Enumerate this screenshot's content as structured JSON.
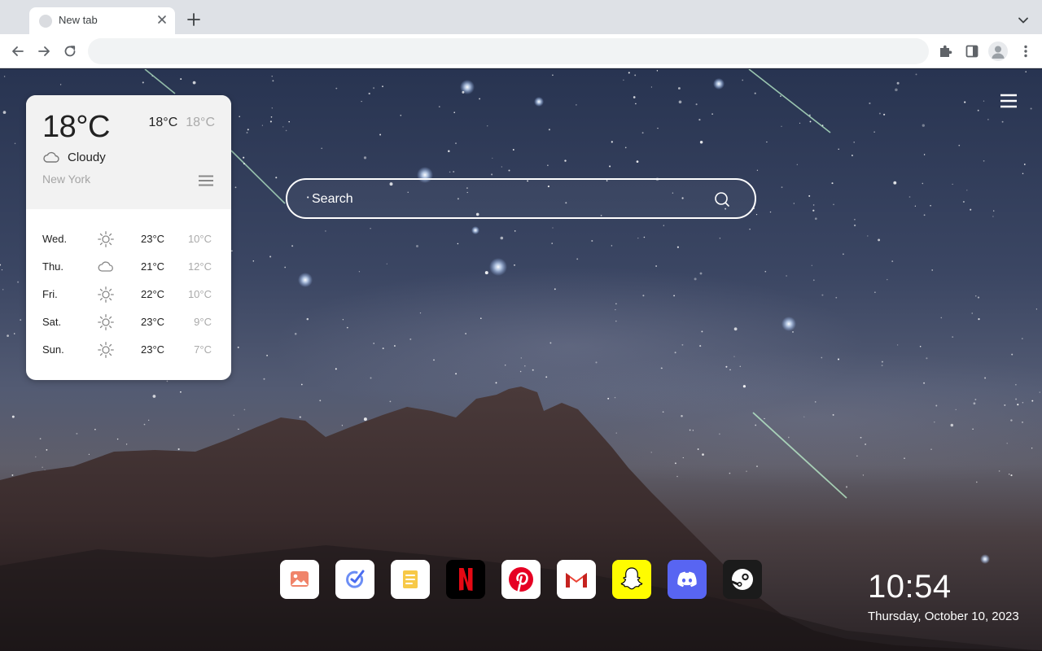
{
  "browser": {
    "tab_title": "New tab",
    "address_value": "",
    "icons": {
      "back": "arrow-left-icon",
      "forward": "arrow-right-icon",
      "reload": "reload-icon",
      "extensions": "puzzle-icon",
      "side_panel": "side-panel-icon",
      "profile": "profile-avatar-icon",
      "menu": "kebab-menu-icon"
    }
  },
  "weather": {
    "current_temp": "18°C",
    "high": "18°C",
    "low": "18°C",
    "condition": "Cloudy",
    "condition_icon": "cloud-icon",
    "city": "New York",
    "forecast": [
      {
        "day": "Wed.",
        "icon": "sun-icon",
        "high": "23°C",
        "low": "10°C"
      },
      {
        "day": "Thu.",
        "icon": "cloud-icon",
        "high": "21°C",
        "low": "12°C"
      },
      {
        "day": "Fri.",
        "icon": "sun-icon",
        "high": "22°C",
        "low": "10°C"
      },
      {
        "day": "Sat.",
        "icon": "sun-icon",
        "high": "23°C",
        "low": "9°C"
      },
      {
        "day": "Sun.",
        "icon": "sun-icon",
        "high": "23°C",
        "low": "7°C"
      }
    ]
  },
  "search": {
    "placeholder": "Search"
  },
  "dock": [
    {
      "app": "Gallery",
      "icon": "gallery-icon"
    },
    {
      "app": "Tasks",
      "icon": "task-check-icon"
    },
    {
      "app": "Notes",
      "icon": "notes-icon"
    },
    {
      "app": "Netflix",
      "icon": "netflix-icon"
    },
    {
      "app": "Pinterest",
      "icon": "pinterest-icon"
    },
    {
      "app": "Gmail",
      "icon": "gmail-icon"
    },
    {
      "app": "Snapchat",
      "icon": "snapchat-icon"
    },
    {
      "app": "Discord",
      "icon": "discord-icon"
    },
    {
      "app": "Steam",
      "icon": "steam-icon"
    }
  ],
  "clock": {
    "time": "10:54",
    "date": "Thursday, October 10, 2023"
  },
  "colors": {
    "tabstrip": "#dee1e6",
    "netflix_red": "#e50914",
    "pinterest_red": "#e60023",
    "snapchat_yellow": "#fffc00",
    "discord_blurple": "#5865f2",
    "steam_dark": "#1b1b1b"
  }
}
